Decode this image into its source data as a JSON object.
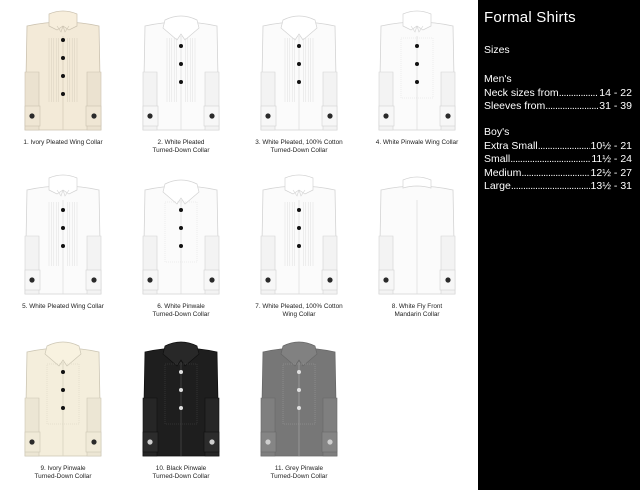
{
  "shirts": [
    {
      "caption": "1. Ivory Pleated Wing Collar",
      "color": "#f3ead8",
      "collar": "wing",
      "front": "pleated",
      "buttons": 4
    },
    {
      "caption": "2. White Pleated\nTurned-Down Collar",
      "color": "#fbfbfb",
      "collar": "turndown",
      "front": "pleated",
      "buttons": 3
    },
    {
      "caption": "3. White Pleated, 100% Cotton\nTurned-Down Collar",
      "color": "#fbfbfb",
      "collar": "turndown",
      "front": "pleated",
      "buttons": 3
    },
    {
      "caption": "4. White Pinwale Wing Collar",
      "color": "#fbfbfb",
      "collar": "wing",
      "front": "pinwale",
      "buttons": 3
    },
    {
      "caption": "5. White Pleated Wing Collar",
      "color": "#fbfbfb",
      "collar": "wing",
      "front": "pleated",
      "buttons": 3
    },
    {
      "caption": "6. White Pinwale\nTurned-Down Collar",
      "color": "#fbfbfb",
      "collar": "turndown",
      "front": "pinwale",
      "buttons": 3
    },
    {
      "caption": "7. White Pleated, 100% Cotton\nWing Collar",
      "color": "#fbfbfb",
      "collar": "wing",
      "front": "pleated",
      "buttons": 3
    },
    {
      "caption": "8. White Fly Front\nMandarin Collar",
      "color": "#fbfbfb",
      "collar": "mandarin",
      "front": "fly",
      "buttons": 0
    },
    {
      "caption": "9. Ivory Pinwale\nTurned-Down Collar",
      "color": "#f4eedc",
      "collar": "turndown",
      "front": "pinwale",
      "buttons": 3
    },
    {
      "caption": "10. Black Pinwale\nTurned-Down Collar",
      "color": "#1e1e1e",
      "collar": "turndown",
      "front": "pinwale",
      "buttons": 3
    },
    {
      "caption": "11. Grey Pinwale\nTurned-Down Collar",
      "color": "#777777",
      "collar": "turndown",
      "front": "pinwale",
      "buttons": 3
    }
  ],
  "panel": {
    "title": "Formal Shirts",
    "sizes_heading": "Sizes",
    "mens": {
      "heading": "Men's",
      "rows": [
        {
          "label": "Neck sizes from",
          "value": "14 - 22"
        },
        {
          "label": "Sleeves from",
          "value": "31 - 39"
        }
      ]
    },
    "boys": {
      "heading": "Boy's",
      "rows": [
        {
          "label": "Extra Small ",
          "value": "10½ - 21"
        },
        {
          "label": "Small",
          "value": "11½ - 24"
        },
        {
          "label": "Medium ",
          "value": "12½ - 27"
        },
        {
          "label": "Large ",
          "value": "13½ - 31"
        }
      ]
    }
  },
  "colors": {
    "panel_background": "#000000",
    "panel_text": "#ffffff",
    "page_background": "#ffffff",
    "stud": "#111111"
  }
}
